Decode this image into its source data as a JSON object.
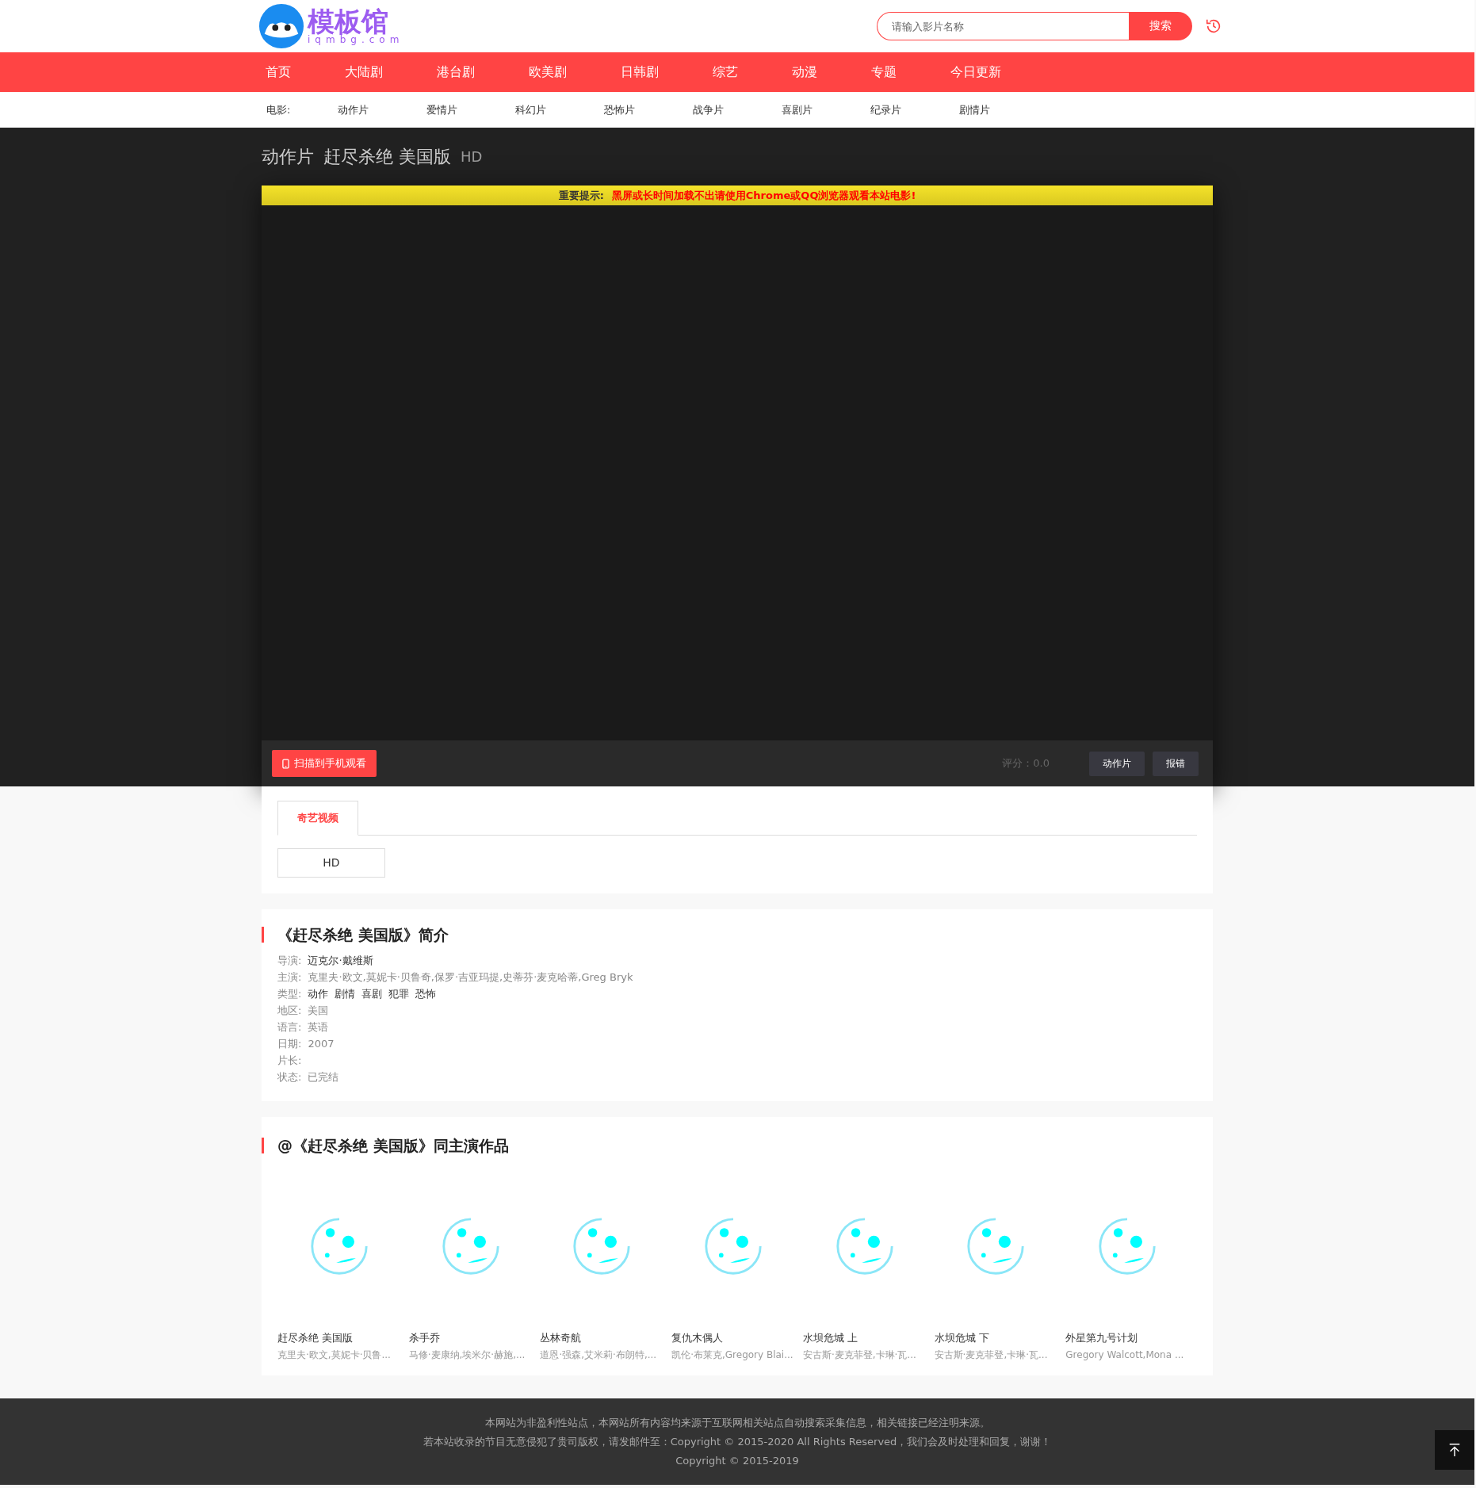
{
  "header": {
    "logo": {
      "title": "模板馆",
      "subtitle": "iqmbg.com"
    },
    "search": {
      "placeholder": "请输入影片名称",
      "button": "搜索"
    }
  },
  "nav": [
    {
      "label": "首页"
    },
    {
      "label": "大陆剧"
    },
    {
      "label": "港台剧"
    },
    {
      "label": "欧美剧"
    },
    {
      "label": "日韩剧"
    },
    {
      "label": "综艺"
    },
    {
      "label": "动漫"
    },
    {
      "label": "专题"
    },
    {
      "label": "今日更新"
    }
  ],
  "subnav": {
    "label": "电影:",
    "items": [
      "动作片",
      "爱情片",
      "科幻片",
      "恐怖片",
      "战争片",
      "喜剧片",
      "纪录片",
      "剧情片"
    ]
  },
  "video": {
    "category": "动作片",
    "title": "赶尽杀绝 美国版",
    "quality": "HD",
    "notice_label": "重要提示:",
    "notice": "黑屏或长时间加载不出请使用Chrome或QQ浏览器观看本站电影!"
  },
  "player_bar": {
    "mobile_button": "扫描到手机观看",
    "rating": "评分：0.0",
    "buttons": [
      "动作片",
      "报错"
    ]
  },
  "sources": {
    "tabs": [
      {
        "label": "奇艺视频",
        "selected": true
      }
    ],
    "episodes": [
      "HD"
    ]
  },
  "intro": {
    "heading": "《赶尽杀绝 美国版》简介",
    "fields": [
      {
        "label": "导演:",
        "links": [
          "迈克尔·戴维斯"
        ]
      },
      {
        "label": "主演:",
        "value": "克里夫·欧文,莫妮卡·贝鲁奇,保罗·吉亚玛提,史蒂芬·麦克哈蒂,Greg Bryk"
      },
      {
        "label": "类型:",
        "links": [
          "动作",
          "剧情",
          "喜剧",
          "犯罪",
          "恐怖"
        ]
      },
      {
        "label": "地区:",
        "value": "美国"
      },
      {
        "label": "语言:",
        "value": "英语"
      },
      {
        "label": "日期:",
        "value": "2007"
      },
      {
        "label": "片长:"
      },
      {
        "label": "状态:",
        "value": "已完结"
      }
    ]
  },
  "cast_works": {
    "heading": "@《赶尽杀绝 美国版》同主演作品",
    "items": [
      {
        "title": "赶尽杀绝 美国版",
        "cast": "克里夫·欧文,莫妮卡·贝鲁..."
      },
      {
        "title": "杀手乔",
        "cast": "马修·麦康纳,埃米尔·赫施,..."
      },
      {
        "title": "丛林奇航",
        "cast": "道恩·强森,艾米莉·布朗特,..."
      },
      {
        "title": "复仇木偶人",
        "cast": "凯伦·布莱克,Gregory Blai..."
      },
      {
        "title": "水坝危城 上",
        "cast": "安古斯·麦克菲登,卡琳·瓦..."
      },
      {
        "title": "水坝危城 下",
        "cast": "安古斯·麦克菲登,卡琳·瓦..."
      },
      {
        "title": "外星第九号计划",
        "cast": "Gregory Walcott,Mona ..."
      }
    ]
  },
  "footer": {
    "lines": [
      "本网站为非盈利性站点，本网站所有内容均来源于互联网相关站点自动搜索采集信息，相关链接已经注明来源。",
      "若本站收录的节目无意侵犯了贵司版权，请发邮件至：Copyright © 2015-2020 All Rights Reserved，我们会及时处理和回复，谢谢！",
      "Copyright © 2015-2019"
    ]
  }
}
